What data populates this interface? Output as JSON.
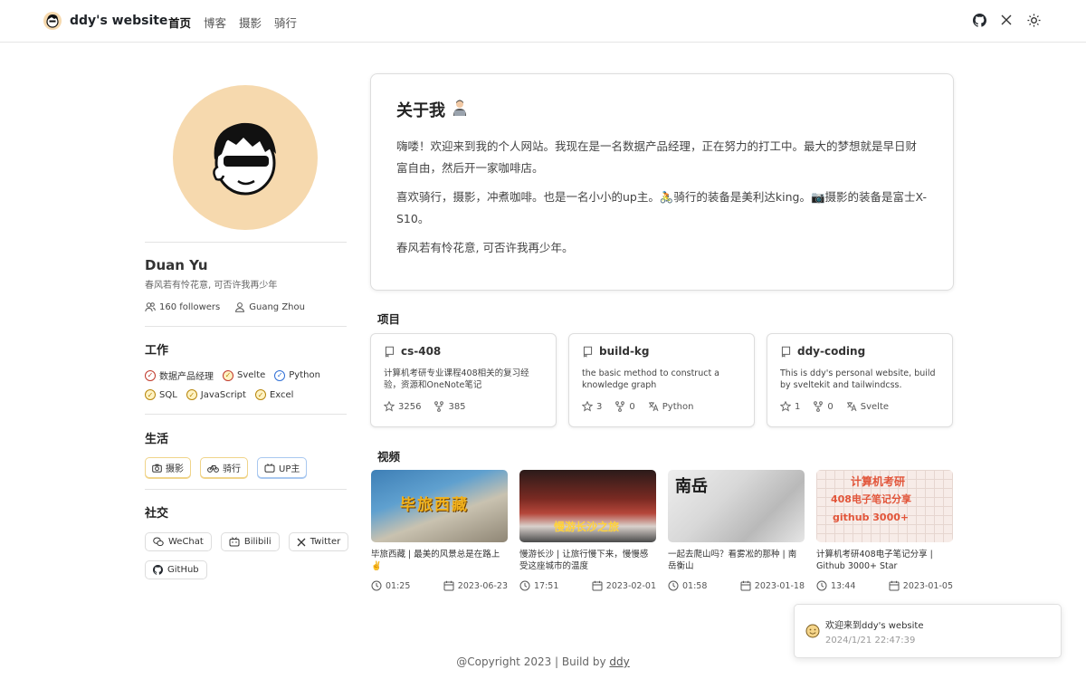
{
  "header": {
    "brand": "ddy's website",
    "nav": [
      "首页",
      "博客",
      "摄影",
      "骑行"
    ]
  },
  "profile": {
    "name": "Duan Yu",
    "motto": "春风若有怜花意, 可否许我再少年",
    "followers": "160 followers",
    "location": "Guang Zhou"
  },
  "work": {
    "title": "工作",
    "items": [
      "数据产品经理",
      "Svelte",
      "Python",
      "SQL",
      "JavaScript",
      "Excel"
    ]
  },
  "life": {
    "title": "生活",
    "items": [
      "摄影",
      "骑行",
      "UP主"
    ]
  },
  "social": {
    "title": "社交",
    "items": [
      "WeChat",
      "Bilibili",
      "Twitter",
      "GitHub"
    ]
  },
  "about": {
    "title": "关于我",
    "p1": "嗨喽！欢迎来到我的个人网站。我现在是一名数据产品经理，正在努力的打工中。最大的梦想就是早日财富自由，然后开一家咖啡店。",
    "p2": "喜欢骑行，摄影，冲煮咖啡。也是一名小小的up主。🚴骑行的装备是美利达king。📷摄影的装备是富士X-S10。",
    "p3": "春风若有怜花意, 可否许我再少年。"
  },
  "projects": {
    "title": "项目",
    "items": [
      {
        "name": "cs-408",
        "desc": "计算机考研专业课程408相关的复习经验，资源和OneNote笔记",
        "stars": "3256",
        "forks": "385",
        "lang": ""
      },
      {
        "name": "build-kg",
        "desc": "the basic method to construct a knowledge graph",
        "stars": "3",
        "forks": "0",
        "lang": "Python"
      },
      {
        "name": "ddy-coding",
        "desc": "This is ddy's personal website, build by sveltekit and tailwindcss.",
        "stars": "1",
        "forks": "0",
        "lang": "Svelte"
      }
    ]
  },
  "videos": {
    "title": "视频",
    "items": [
      {
        "title": "毕旅西藏 | 最美的风景总是在路上 ✌️",
        "duration": "01:25",
        "date": "2023-06-23",
        "thumb_text": "毕旅西藏"
      },
      {
        "title": "慢游长沙 | 让旅行慢下来，慢慢感受这座城市的温度",
        "duration": "17:51",
        "date": "2023-02-01",
        "thumb_text": "慢游长沙之旅"
      },
      {
        "title": "一起去爬山吗？看雾凇的那种 | 南岳衡山",
        "duration": "01:58",
        "date": "2023-01-18",
        "thumb_text": "南岳"
      },
      {
        "title": "计算机考研408电子笔记分享 | Github 3000+ Star",
        "duration": "13:44",
        "date": "2023-01-05",
        "thumb_text": "计算机考研",
        "thumb_text2": "408电子笔记分享",
        "thumb_text3": "github 3000+"
      }
    ]
  },
  "footer": {
    "text": "@Copyright 2023 | Build by",
    "link": "ddy"
  },
  "toast": {
    "message": "欢迎来到ddy's website",
    "time": "2024/1/21 22:47:39"
  },
  "colors": {
    "avatar_bg": "#f6d9ae",
    "check_red": "#c0392b",
    "check_yellow": "#b8860b",
    "check_blue": "#2f6fd6"
  }
}
